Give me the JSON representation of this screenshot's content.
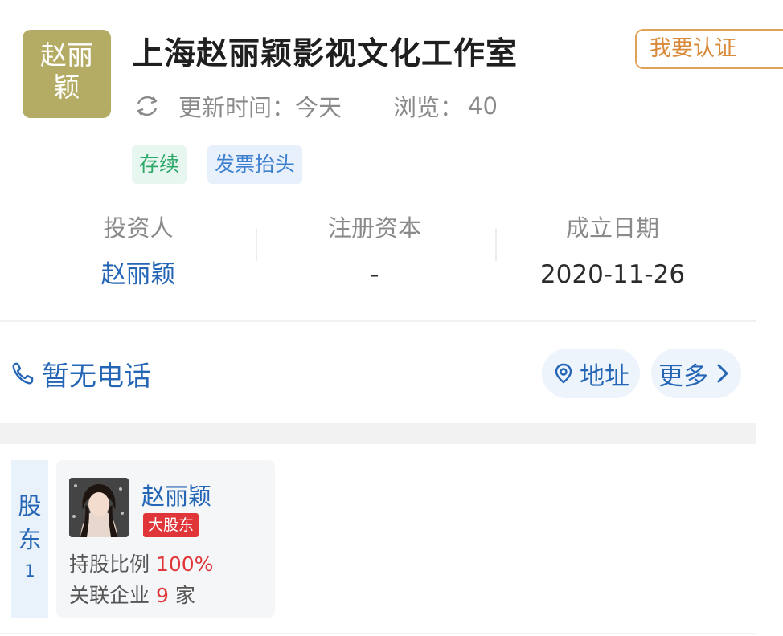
{
  "company": {
    "logo_lines": [
      "赵丽",
      "颖"
    ],
    "name": "上海赵丽颖影视文化工作室",
    "verify_button": "我要认证",
    "update_label": "更新时间：今天",
    "views_label": "浏览：",
    "views_value": "40",
    "tags": {
      "status": "存续",
      "invoice": "发票抬头"
    }
  },
  "info": [
    {
      "label": "投资人",
      "value": "赵丽颖"
    },
    {
      "label": "注册资本",
      "value": "-"
    },
    {
      "label": "成立日期",
      "value": "2020-11-26"
    }
  ],
  "contact": {
    "phone": "暂无电话",
    "address": "地址",
    "more": "更多"
  },
  "shareholders": {
    "side_label_chars": [
      "股",
      "东"
    ],
    "count": "1",
    "holder": {
      "name": "赵丽颖",
      "badge": "大股东",
      "ratio_label": "持股比例",
      "ratio_value": "100%",
      "related_label": "关联企业",
      "related_count": "9",
      "related_unit": "家"
    }
  },
  "colors": {
    "brand_blue": "#2466b5",
    "logo_bg": "#b4ac64",
    "badge_red": "#e0363a",
    "verify_orange": "#d88a3a"
  }
}
